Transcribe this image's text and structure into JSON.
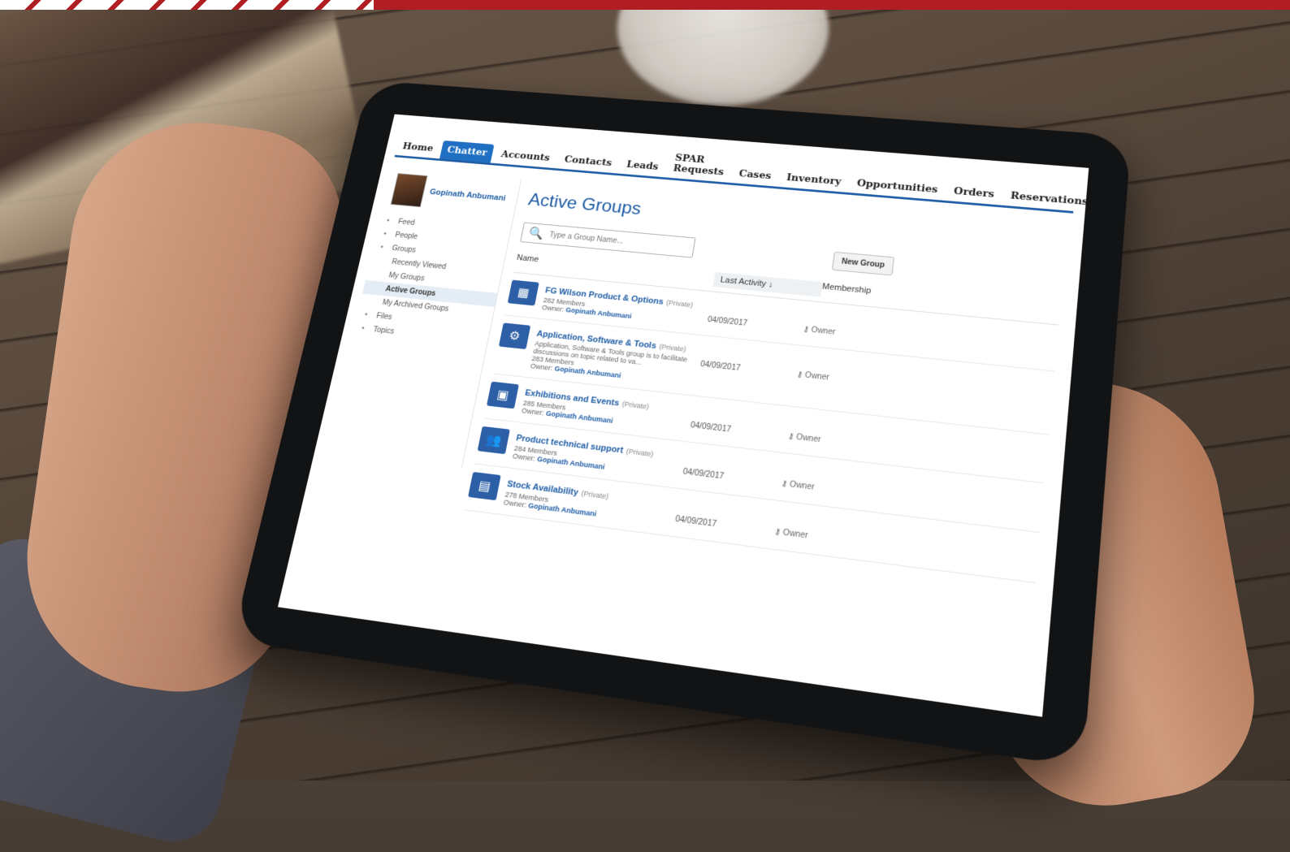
{
  "tabs": [
    "Home",
    "Chatter",
    "Accounts",
    "Contacts",
    "Leads",
    "SPAR Requests",
    "Cases",
    "Inventory",
    "Opportunities",
    "Orders",
    "Reservations"
  ],
  "active_tab": "Chatter",
  "profile": {
    "name": "Gopinath Anbumani"
  },
  "nav": [
    {
      "label": "Feed",
      "icon": "feed-icon"
    },
    {
      "label": "People",
      "icon": "people-icon"
    },
    {
      "label": "Groups",
      "icon": "groups-icon"
    },
    {
      "label": "Recently Viewed",
      "sub": true
    },
    {
      "label": "My Groups",
      "sub": true
    },
    {
      "label": "Active Groups",
      "sub": true,
      "active": true
    },
    {
      "label": "My Archived Groups",
      "sub": true
    },
    {
      "label": "Files",
      "icon": "files-icon"
    },
    {
      "label": "Topics",
      "icon": "topics-icon"
    }
  ],
  "page": {
    "title": "Active Groups",
    "search_placeholder": "Type a Group Name...",
    "new_group": "New Group"
  },
  "columns": {
    "name": "Name",
    "last_activity": "Last Activity ↓",
    "membership": "Membership"
  },
  "groups": [
    {
      "name": "FG Wilson Product & Options",
      "privacy": "(Private)",
      "desc": "",
      "members": "282 Members",
      "owner_label": "Owner:",
      "owner": "Gopinath Anbumani",
      "date": "04/09/2017",
      "role": "Owner",
      "icon": "▦"
    },
    {
      "name": "Application, Software & Tools",
      "privacy": "(Private)",
      "desc": "Application, Software & Tools group is to facilitate discussions on topic related to va...",
      "members": "283 Members",
      "owner_label": "Owner:",
      "owner": "Gopinath Anbumani",
      "date": "04/09/2017",
      "role": "Owner",
      "icon": "⚙"
    },
    {
      "name": "Exhibitions and Events",
      "privacy": "(Private)",
      "desc": "",
      "members": "285 Members",
      "owner_label": "Owner:",
      "owner": "Gopinath Anbumani",
      "date": "04/09/2017",
      "role": "Owner",
      "icon": "▣"
    },
    {
      "name": "Product technical support",
      "privacy": "(Private)",
      "desc": "",
      "members": "284 Members",
      "owner_label": "Owner:",
      "owner": "Gopinath Anbumani",
      "date": "04/09/2017",
      "role": "Owner",
      "icon": "👥"
    },
    {
      "name": "Stock Availability",
      "privacy": "(Private)",
      "desc": "",
      "members": "278 Members",
      "owner_label": "Owner:",
      "owner": "Gopinath Anbumani",
      "date": "04/09/2017",
      "role": "Owner",
      "icon": "▤"
    }
  ],
  "colors": {
    "brand_bar": "#b01e23",
    "link": "#1f5da6",
    "active_tab": "#1f6fc2"
  }
}
